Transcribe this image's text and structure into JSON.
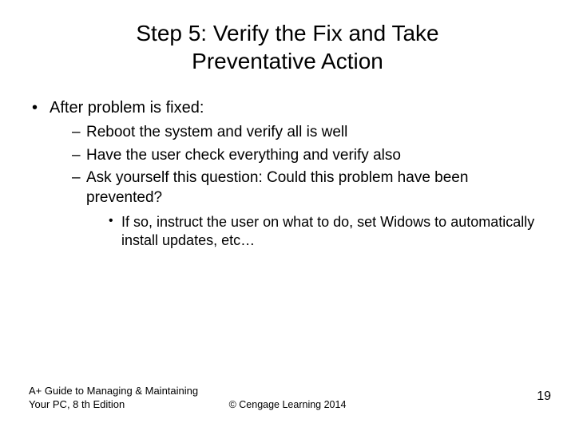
{
  "title_line1": "Step 5: Verify the Fix and Take",
  "title_line2": "Preventative Action",
  "bullets": {
    "main": "After problem is fixed:",
    "sub": [
      "Reboot the system and verify all is well",
      "Have the user check everything and verify also",
      "Ask yourself this question: Could this problem have been prevented?"
    ],
    "subsub": "If so, instruct the user on what to do, set Widows to automatically install updates, etc…"
  },
  "footer": {
    "left_line1": "A+ Guide to Managing & Maintaining",
    "left_line2": "Your PC, 8 th Edition",
    "center": "© Cengage Learning  2014",
    "page": "19"
  }
}
